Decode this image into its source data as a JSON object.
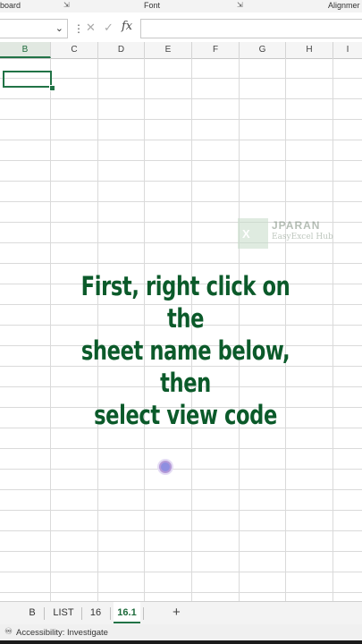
{
  "ribbon_groups": {
    "clipboard_label": "board",
    "font_label": "Font",
    "alignment_label": "Alignmer"
  },
  "formula_bar": {
    "cancel_icon": "close-icon",
    "enter_icon": "check-icon",
    "fx_label": "fx",
    "formula_value": ""
  },
  "columns": [
    "B",
    "C",
    "D",
    "E",
    "F",
    "G",
    "H",
    "I"
  ],
  "watermark": {
    "title": "JPARAN",
    "subtitle": "EasyExcel Hub"
  },
  "caption": {
    "line1": "First, right click on the",
    "line2": "sheet name below, then",
    "line3": "select view code"
  },
  "sheet_tabs": [
    "B",
    "LIST",
    "16",
    "16.1"
  ],
  "active_sheet": "16.1",
  "add_sheet_label": "+",
  "status": {
    "accessibility": "Accessibility: Investigate"
  },
  "colors": {
    "excel_green": "#217346",
    "caption_green": "#0b5a2a"
  }
}
